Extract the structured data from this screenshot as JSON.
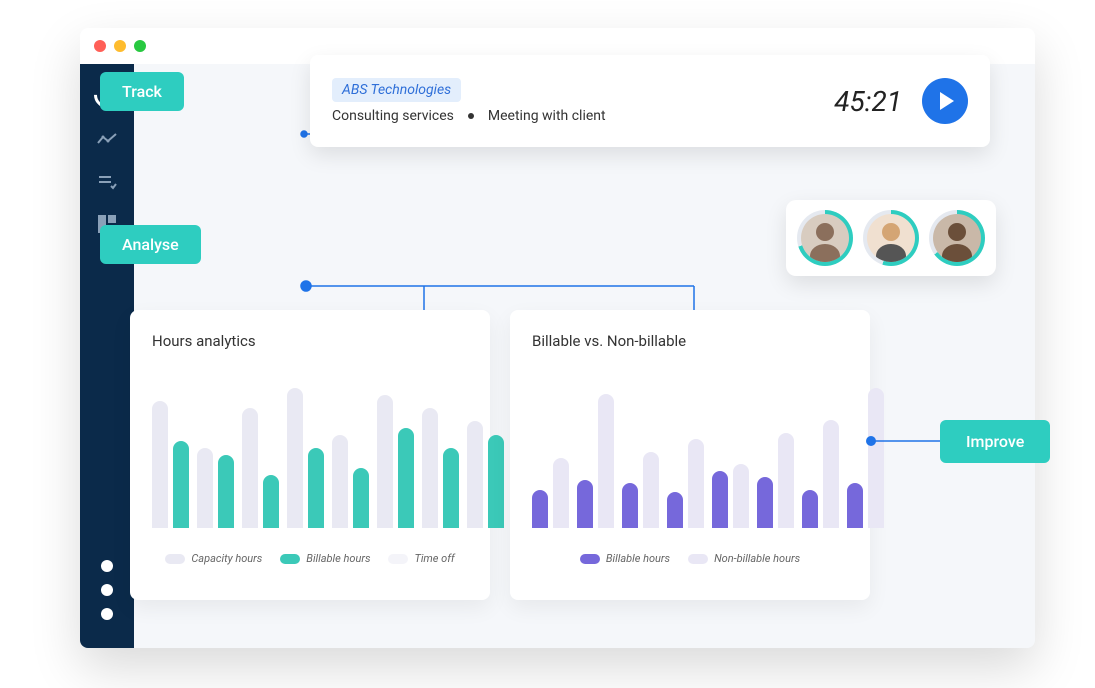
{
  "badges": {
    "track": "Track",
    "analyse": "Analyse",
    "improve": "Improve"
  },
  "timer": {
    "project": "ABS Technologies",
    "task": "Consulting services",
    "subtask": "Meeting with client",
    "elapsed": "45:21"
  },
  "avatars": [
    {
      "progress": 70
    },
    {
      "progress": 55
    },
    {
      "progress": 65
    }
  ],
  "chart_data": [
    {
      "type": "bar",
      "title": "Hours analytics",
      "series": [
        {
          "name": "Capacity hours",
          "values": [
            95,
            60,
            90,
            105,
            70,
            100,
            90,
            80
          ]
        },
        {
          "name": "Billable hours",
          "values": [
            65,
            55,
            40,
            60,
            45,
            75,
            60,
            70
          ]
        },
        {
          "name": "Time off",
          "values": []
        }
      ],
      "legend": [
        "Capacity hours",
        "Billable hours",
        "Time off"
      ]
    },
    {
      "type": "bar",
      "title": "Billable vs. Non-billable",
      "series": [
        {
          "name": "Billable hours",
          "values": [
            30,
            38,
            35,
            28,
            45,
            40,
            30,
            35
          ]
        },
        {
          "name": "Non-billable hours",
          "values": [
            55,
            105,
            60,
            70,
            50,
            75,
            85,
            110
          ]
        }
      ],
      "legend": [
        "Billable hours",
        "Non-billable hours"
      ]
    }
  ]
}
